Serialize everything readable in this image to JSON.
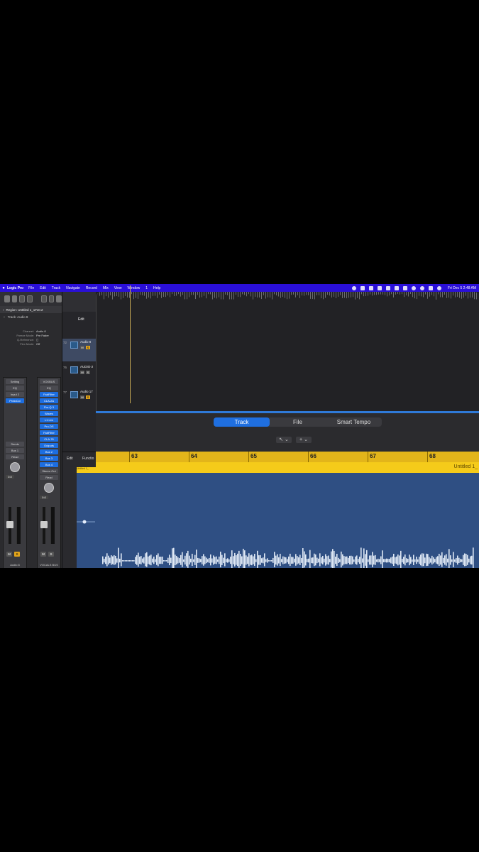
{
  "menubar": {
    "app": "Logic Pro",
    "items": [
      "File",
      "Edit",
      "Track",
      "Navigate",
      "Record",
      "Mix",
      "View",
      "Window",
      "1",
      "Help"
    ],
    "clock": "Fri Dec 5  2:48 AM"
  },
  "inspector": {
    "region_line": "Region: Untitled 1_1#10.2",
    "track_line": "Track: Audio 8",
    "rows": [
      {
        "k": "Channel:",
        "v": "Audio 8"
      },
      {
        "k": "Freeze Mode:",
        "v": "Pre Fader"
      },
      {
        "k": "Q-Reference:",
        "v": "◻"
      },
      {
        "k": "Flex Mode:",
        "v": "Off"
      }
    ],
    "strip1": {
      "setting": "Setting",
      "eq": "EQ",
      "input": "Input 2",
      "slot": "ProtoCol",
      "send": "Sends",
      "bus": "Bus 1",
      "mode": "Read",
      "value": "0.0",
      "name": "Audio 8"
    },
    "strip2": {
      "setting": "VOXBUS",
      "eq": "EQ",
      "plugins": [
        "FabFilter",
        "CLA-2A",
        "Pro-Q 3",
        "Waves",
        "L1 Lim",
        "Pro-DS",
        "FabFilter",
        "CLA-76",
        "Outputs"
      ],
      "buses": [
        "Bus 2",
        "Bus 3",
        "Bus 4"
      ],
      "stereo": "Stereo Out",
      "mode": "Read",
      "value": "0.0",
      "name": "VOCALS BUS"
    }
  },
  "tracks_panel": {
    "edit_label": "Edit",
    "tracks": [
      {
        "num": "72",
        "name": "Audio 8"
      },
      {
        "num": "76",
        "name": "AUDIO-2"
      },
      {
        "num": "77",
        "name": "Audio 17"
      }
    ],
    "lower_edit": "Edit",
    "lower_functions": "Functio"
  },
  "editor": {
    "tabs": [
      "Track",
      "File",
      "Smart Tempo"
    ],
    "active_tab": "Track",
    "pointer_tool": "↖",
    "add_tool": "+"
  },
  "ruler": {
    "bars": [
      "63",
      "64",
      "65",
      "66",
      "67",
      "68"
    ]
  },
  "region": {
    "name": "Untitled 1_",
    "tab_name": "Untitled 1_"
  },
  "colors": {
    "menubar": "#2a0fd8",
    "ruler": "#e3b51a",
    "region": "#f5cb1a",
    "audio_region": "#2f4f83",
    "active_tab": "#1f6fe0",
    "waveform": "#dfe8f5"
  }
}
